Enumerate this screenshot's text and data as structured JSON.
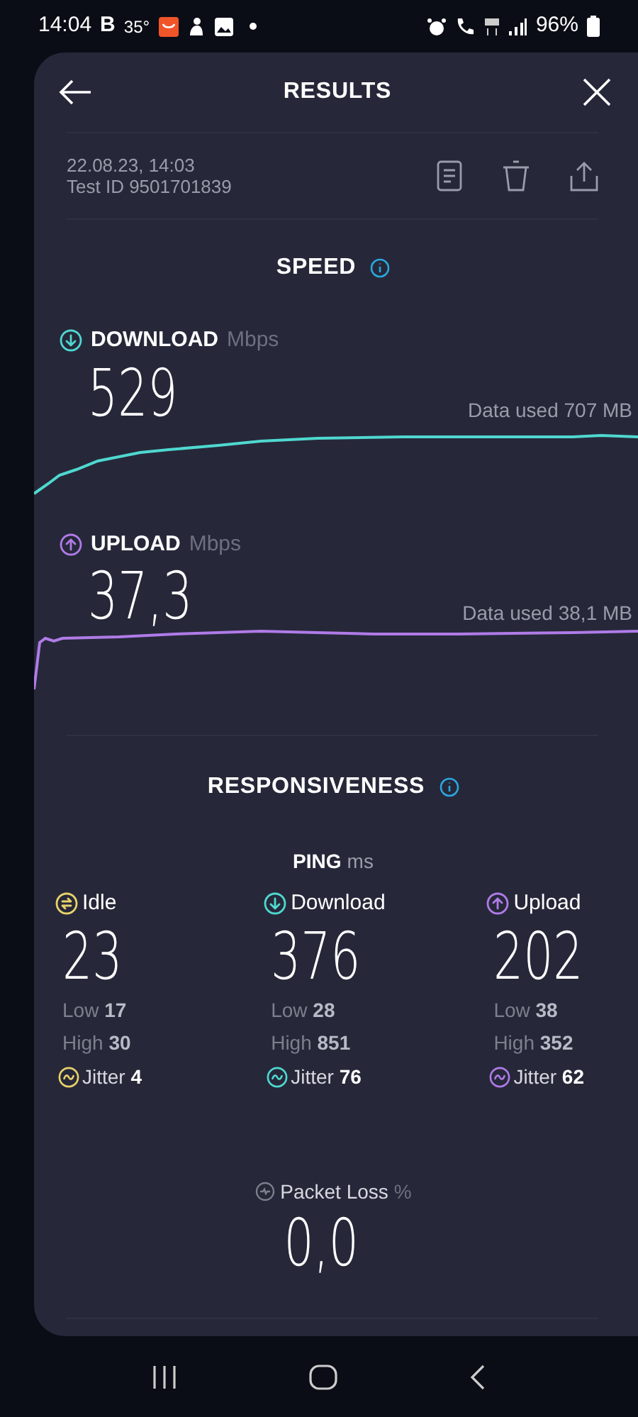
{
  "status_bar": {
    "time": "14:04",
    "notifications": [
      "B",
      "35°"
    ],
    "battery": "96%"
  },
  "header": {
    "title": "RESULTS"
  },
  "meta": {
    "date": "22.08.23, 14:03",
    "test_id": "Test ID 9501701839"
  },
  "speed": {
    "title": "SPEED",
    "metrics": [
      {
        "kind": "download",
        "color": "#4fd8d0",
        "label": "DOWNLOAD",
        "unit": "Mbps",
        "value": "529",
        "data_used": "Data used 707 MB"
      },
      {
        "kind": "upload",
        "color": "#b07be8",
        "label": "UPLOAD",
        "unit": "Mbps",
        "value": "37,3",
        "data_used": "Data used 38,1 MB"
      }
    ]
  },
  "responsiveness": {
    "title": "RESPONSIVENESS",
    "ping": {
      "label": "PING",
      "unit": "ms"
    },
    "columns": [
      {
        "kind": "idle",
        "color": "#e8d26a",
        "label": "Idle",
        "value": "23",
        "low_label": "Low",
        "low": "17",
        "high_label": "High",
        "high": "30",
        "jitter_label": "Jitter",
        "jitter": "4"
      },
      {
        "kind": "download",
        "color": "#4fd8d0",
        "label": "Download",
        "value": "376",
        "low_label": "Low",
        "low": "28",
        "high_label": "High",
        "high": "851",
        "jitter_label": "Jitter",
        "jitter": "76"
      },
      {
        "kind": "upload",
        "color": "#b07be8",
        "label": "Upload",
        "value": "202",
        "low_label": "Low",
        "low": "38",
        "high_label": "High",
        "high": "352",
        "jitter_label": "Jitter",
        "jitter": "62"
      }
    ],
    "packet_loss": {
      "label": "Packet Loss",
      "unit": "%",
      "value": "0,0"
    }
  }
}
